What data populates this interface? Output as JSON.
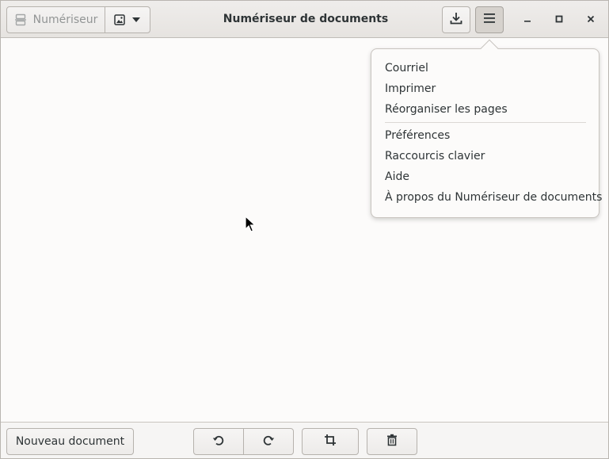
{
  "window": {
    "title": "Numériseur de documents"
  },
  "header": {
    "scan_label": "Numériseur",
    "scan_icon": "scanner-icon",
    "type_icon": "image-icon",
    "save_icon": "download-icon",
    "menu_icon": "hamburger-menu-icon"
  },
  "menu": {
    "group1": [
      "Courriel",
      "Imprimer",
      "Réorganiser les pages"
    ],
    "group2": [
      "Préférences",
      "Raccourcis clavier",
      "Aide",
      "À propos du Numériseur de documents"
    ]
  },
  "footer": {
    "new_document_label": "Nouveau document",
    "rotate_left_icon": "rotate-left-icon",
    "rotate_right_icon": "rotate-right-icon",
    "crop_icon": "crop-icon",
    "delete_icon": "trash-icon"
  }
}
